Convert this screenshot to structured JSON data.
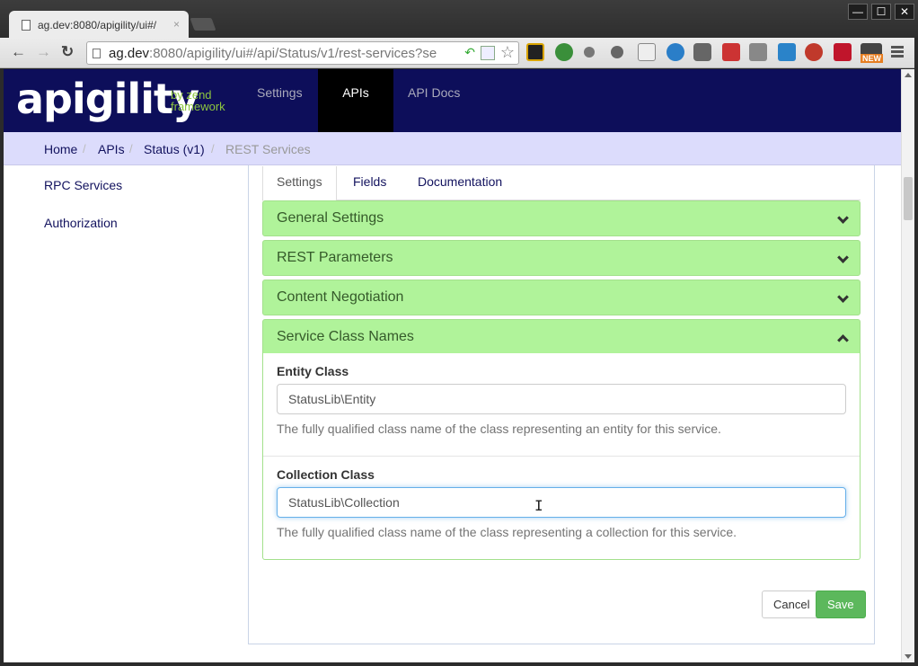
{
  "browser": {
    "tab_title": "ag.dev:8080/apigility/ui#/",
    "tab_close": "×",
    "url_host": "ag.dev",
    "url_rest": ":8080/apigility/ui#/api/Status/v1/rest-services?se",
    "back": "←",
    "forward": "→",
    "reload": "↻",
    "star": "☆",
    "window_buttons": [
      "—",
      "☐",
      "✕"
    ],
    "extension_badge": "NEW"
  },
  "header": {
    "logo": "apigility",
    "logo_sub_line1": "by zend",
    "logo_sub_line2": "framework",
    "nav": [
      {
        "label": "Settings",
        "active": false
      },
      {
        "label": "APIs",
        "active": true
      },
      {
        "label": "API Docs",
        "active": false
      }
    ]
  },
  "breadcrumb": [
    "Home",
    "APIs",
    "Status (v1)",
    "REST Services"
  ],
  "breadcrumb_sep": "/",
  "sidebar": {
    "items": [
      "RPC Services",
      "Authorization"
    ]
  },
  "tabs": [
    "Settings",
    "Fields",
    "Documentation"
  ],
  "accordion": [
    {
      "title": "General Settings",
      "expanded": false
    },
    {
      "title": "REST Parameters",
      "expanded": false
    },
    {
      "title": "Content Negotiation",
      "expanded": false
    },
    {
      "title": "Service Class Names",
      "expanded": true
    }
  ],
  "form": {
    "entity_label": "Entity Class",
    "entity_value": "StatusLib\\Entity",
    "entity_help": "The fully qualified class name of the class representing an entity for this service.",
    "collection_label": "Collection Class",
    "collection_value": "StatusLib\\Collection",
    "collection_help": "The fully qualified class name of the class representing a collection for this service.",
    "cursor": "I"
  },
  "buttons": {
    "cancel": "Cancel",
    "save": "Save"
  },
  "colors": {
    "header_bg": "#0d0e5a",
    "breadcrumb_bg": "#dcdcfc",
    "accordion_bg": "#b0f39a",
    "save_bg": "#5cb85c",
    "logo_accent": "#8dc63f"
  }
}
